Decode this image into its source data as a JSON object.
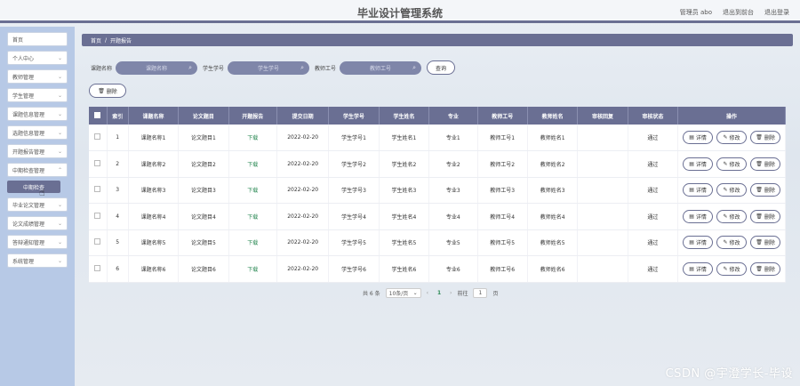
{
  "app_title": "毕业设计管理系统",
  "top_links": [
    "管理员 abo",
    "退出到前台",
    "退出登录"
  ],
  "sidebar": {
    "items": [
      {
        "label": "首页",
        "chev": ""
      },
      {
        "label": "个人中心",
        "chev": "⌄"
      },
      {
        "label": "教师管理",
        "chev": "⌄"
      },
      {
        "label": "学生管理",
        "chev": "⌄"
      },
      {
        "label": "课题信息管理",
        "chev": "⌄"
      },
      {
        "label": "选题信息管理",
        "chev": "⌄"
      },
      {
        "label": "开题报告管理",
        "chev": "⌄"
      },
      {
        "label": "中期检查管理",
        "chev": "⌃"
      }
    ],
    "sub_item": "中期检查",
    "items_after": [
      {
        "label": "毕业论文管理",
        "chev": "⌄"
      },
      {
        "label": "论文成绩管理",
        "chev": "⌄"
      },
      {
        "label": "答辩通知管理",
        "chev": "⌄"
      },
      {
        "label": "系统管理",
        "chev": "⌄"
      }
    ]
  },
  "breadcrumb": {
    "home": "首页",
    "sep": "/",
    "current": "开题报告"
  },
  "search": {
    "f1_label": "课题名称",
    "f1_placeholder": "课题名称",
    "f2_label": "学生学号",
    "f2_placeholder": "学生学号",
    "f3_label": "教师工号",
    "f3_placeholder": "教师工号",
    "button": "查询"
  },
  "delete_button": "删除",
  "table": {
    "headers": [
      "索引",
      "课题名称",
      "论文题目",
      "开题报告",
      "提交日期",
      "学生学号",
      "学生姓名",
      "专业",
      "教师工号",
      "教师姓名",
      "审核回复",
      "审核状态",
      "操作"
    ],
    "rows": [
      [
        "1",
        "课题名称1",
        "论文题目1",
        "下载",
        "2022-02-20",
        "学生学号1",
        "学生姓名1",
        "专业1",
        "教师工号1",
        "教师姓名1",
        "",
        "通过"
      ],
      [
        "2",
        "课题名称2",
        "论文题目2",
        "下载",
        "2022-02-20",
        "学生学号2",
        "学生姓名2",
        "专业2",
        "教师工号2",
        "教师姓名2",
        "",
        "通过"
      ],
      [
        "3",
        "课题名称3",
        "论文题目3",
        "下载",
        "2022-02-20",
        "学生学号3",
        "学生姓名3",
        "专业3",
        "教师工号3",
        "教师姓名3",
        "",
        "通过"
      ],
      [
        "4",
        "课题名称4",
        "论文题目4",
        "下载",
        "2022-02-20",
        "学生学号4",
        "学生姓名4",
        "专业4",
        "教师工号4",
        "教师姓名4",
        "",
        "通过"
      ],
      [
        "5",
        "课题名称5",
        "论文题目5",
        "下载",
        "2022-02-20",
        "学生学号5",
        "学生姓名5",
        "专业5",
        "教师工号5",
        "教师姓名5",
        "",
        "通过"
      ],
      [
        "6",
        "课题名称6",
        "论文题目6",
        "下载",
        "2022-02-20",
        "学生学号6",
        "学生姓名6",
        "专业6",
        "教师工号6",
        "教师姓名6",
        "",
        "通过"
      ]
    ],
    "op_labels": [
      "详情",
      "修改",
      "删除"
    ]
  },
  "pagination": {
    "total": "共 6 条",
    "page_size": "10条/页",
    "current": "1",
    "goto": "前往",
    "goto_value": "1",
    "page_suffix": "页"
  },
  "watermark": "CSDN @宇澄学长-毕设"
}
